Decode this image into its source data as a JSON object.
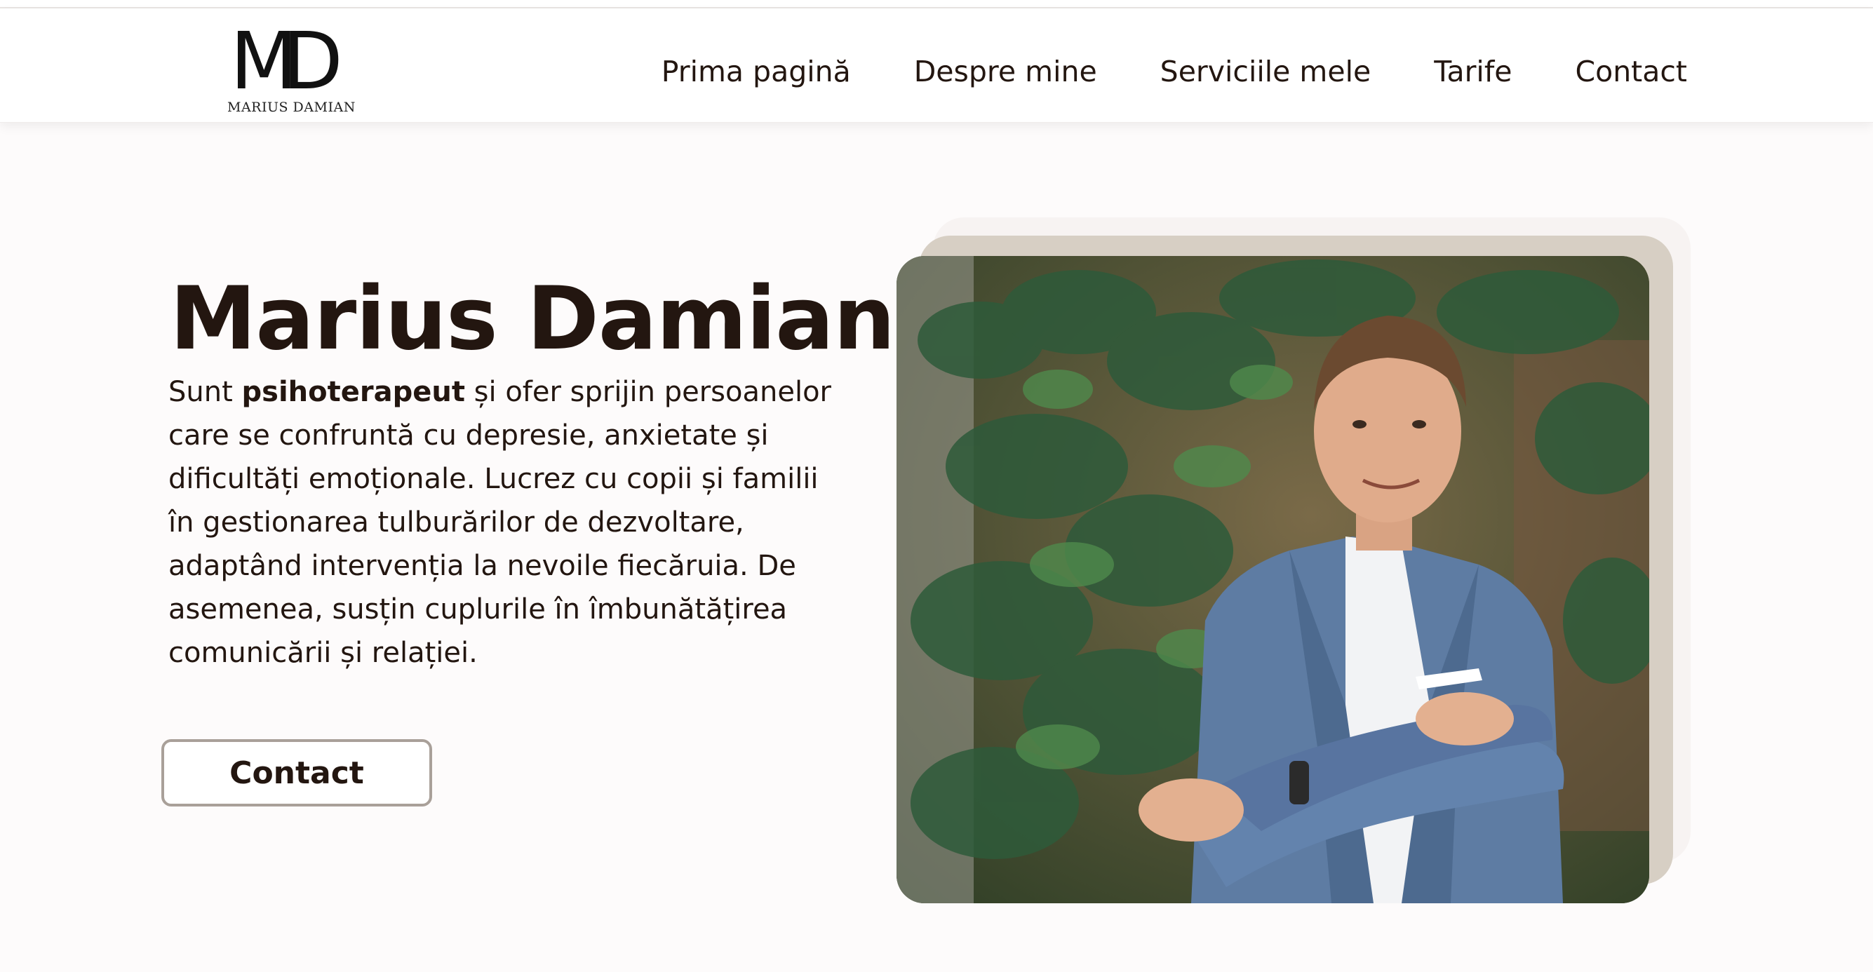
{
  "logo": {
    "mark": "MD",
    "name": "MARIUS DAMIAN"
  },
  "nav": {
    "items": [
      {
        "label": "Prima pagină"
      },
      {
        "label": "Despre mine"
      },
      {
        "label": "Serviciile mele"
      },
      {
        "label": "Tarife"
      },
      {
        "label": "Contact"
      }
    ]
  },
  "hero": {
    "title": "Marius Damian",
    "bio_intro": "Sunt ",
    "bio_bold": "psihoterapeut",
    "bio_rest": " și ofer sprijin persoanelor care se confruntă cu depresie, anxietate și dificultăți emoționale. Lucrez cu copii și familii în gestionarea tulburărilor de dezvoltare, adaptând intervenția la nevoile fiecăruia. De asemenea, susțin cuplurile în îmbunătățirea comunicării și relației.",
    "button_label": "Contact"
  },
  "colors": {
    "text": "#231610",
    "frame_tan": "#d7cfc4",
    "button_border": "#a9a099",
    "jacket": "#5e7ca3",
    "foliage": "#3d5233"
  }
}
